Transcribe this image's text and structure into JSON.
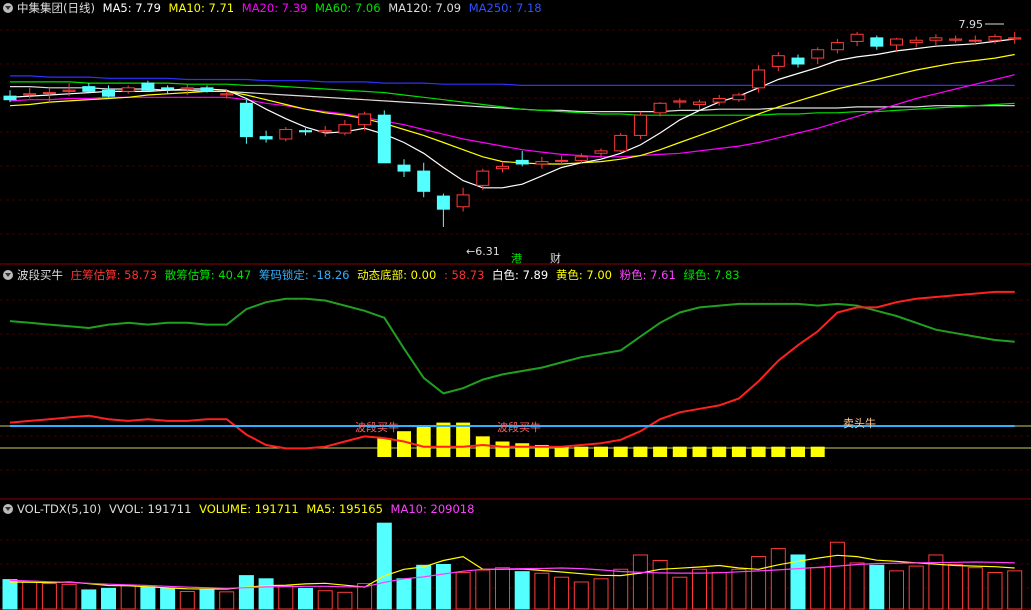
{
  "price_legend": {
    "title": "中集集团(日线)",
    "ma5": "MA5: 7.79",
    "ma10": "MA10: 7.71",
    "ma20": "MA20: 7.39",
    "ma60": "MA60: 7.06",
    "ma120": "MA120: 7.09",
    "ma250": "MA250: 7.18"
  },
  "ind_legend": {
    "title": "波段买牛",
    "i1": "庄筹估算: 58.73",
    "i2": "散筹估算: 40.47",
    "i3": "筹码锁定: -18.26",
    "i4": "动态底部: 0.00",
    "i5": ": 58.73",
    "i6": "白色: 7.89",
    "i7": "黄色: 7.00",
    "i8": "粉色: 7.61",
    "i9": "绿色: 7.83"
  },
  "vol_legend": {
    "title": "VOL-TDX(5,10)",
    "v1": "VVOL: 191711",
    "v2": "VOLUME: 191711",
    "v3": "MA5: 195165",
    "v4": "MA10: 209018"
  },
  "annotations": {
    "high": "7.95",
    "low": "6.31",
    "gang": "港",
    "cai": "财",
    "buy1": "波段买牛",
    "buy2": "波段买牛",
    "sell": "卖头牛"
  },
  "colors": {
    "up": "#ff3b3b",
    "down": "#54ffff",
    "ma5": "#ffffff",
    "ma10": "#ffff00",
    "ma20": "#ff00ff",
    "ma60": "#00e000",
    "ma120": "#dddddd",
    "ma250": "#3030ff",
    "frame": "#8b0000",
    "bar": "#ffff00"
  },
  "chart_data": [
    {
      "type": "candlestick",
      "ylim": [
        6.1,
        8.05
      ],
      "candles": [
        [
          7.41,
          7.46,
          7.36,
          7.38
        ],
        [
          7.42,
          7.48,
          7.39,
          7.43
        ],
        [
          7.44,
          7.49,
          7.35,
          7.44
        ],
        [
          7.45,
          7.52,
          7.41,
          7.46
        ],
        [
          7.49,
          7.52,
          7.44,
          7.45
        ],
        [
          7.46,
          7.5,
          7.4,
          7.41
        ],
        [
          7.45,
          7.5,
          7.43,
          7.48
        ],
        [
          7.52,
          7.54,
          7.45,
          7.46
        ],
        [
          7.48,
          7.5,
          7.43,
          7.47
        ],
        [
          7.47,
          7.51,
          7.42,
          7.48
        ],
        [
          7.48,
          7.5,
          7.44,
          7.45
        ],
        [
          7.42,
          7.46,
          7.39,
          7.43
        ],
        [
          7.35,
          7.38,
          7.01,
          7.07
        ],
        [
          7.07,
          7.12,
          7.02,
          7.05
        ],
        [
          7.05,
          7.15,
          7.03,
          7.13
        ],
        [
          7.12,
          7.14,
          7.08,
          7.11
        ],
        [
          7.11,
          7.16,
          7.07,
          7.12
        ],
        [
          7.1,
          7.21,
          7.08,
          7.17
        ],
        [
          7.17,
          7.28,
          7.12,
          7.26
        ],
        [
          7.25,
          7.29,
          6.85,
          6.85
        ],
        [
          6.83,
          6.88,
          6.73,
          6.78
        ],
        [
          6.78,
          6.85,
          6.56,
          6.61
        ],
        [
          6.57,
          6.59,
          6.31,
          6.46
        ],
        [
          6.48,
          6.64,
          6.44,
          6.58
        ],
        [
          6.66,
          6.8,
          6.62,
          6.78
        ],
        [
          6.8,
          6.86,
          6.77,
          6.82
        ],
        [
          6.87,
          6.95,
          6.82,
          6.84
        ],
        [
          6.84,
          6.9,
          6.8,
          6.86
        ],
        [
          6.87,
          6.91,
          6.83,
          6.87
        ],
        [
          6.87,
          6.93,
          6.84,
          6.9
        ],
        [
          6.93,
          6.97,
          6.89,
          6.95
        ],
        [
          6.95,
          7.1,
          6.94,
          7.08
        ],
        [
          7.08,
          7.28,
          7.05,
          7.25
        ],
        [
          7.27,
          7.36,
          7.24,
          7.35
        ],
        [
          7.36,
          7.39,
          7.31,
          7.37
        ],
        [
          7.34,
          7.38,
          7.3,
          7.36
        ],
        [
          7.36,
          7.42,
          7.33,
          7.39
        ],
        [
          7.38,
          7.44,
          7.36,
          7.42
        ],
        [
          7.48,
          7.67,
          7.44,
          7.63
        ],
        [
          7.66,
          7.78,
          7.62,
          7.75
        ],
        [
          7.73,
          7.76,
          7.65,
          7.68
        ],
        [
          7.73,
          7.82,
          7.68,
          7.8
        ],
        [
          7.8,
          7.89,
          7.77,
          7.86
        ],
        [
          7.87,
          7.95,
          7.83,
          7.93
        ],
        [
          7.9,
          7.92,
          7.8,
          7.83
        ],
        [
          7.84,
          7.9,
          7.79,
          7.89
        ],
        [
          7.86,
          7.91,
          7.82,
          7.88
        ],
        [
          7.88,
          7.93,
          7.84,
          7.9
        ],
        [
          7.88,
          7.92,
          7.86,
          7.89
        ],
        [
          7.88,
          7.92,
          7.84,
          7.88
        ],
        [
          7.88,
          7.93,
          7.85,
          7.91
        ],
        [
          7.89,
          7.95,
          7.85,
          7.9
        ]
      ],
      "ma": {
        "ma5": [
          7.4,
          7.41,
          7.42,
          7.43,
          7.44,
          7.45,
          7.45,
          7.45,
          7.46,
          7.47,
          7.47,
          7.46,
          7.39,
          7.3,
          7.22,
          7.15,
          7.1,
          7.11,
          7.14,
          7.09,
          7.02,
          6.93,
          6.81,
          6.7,
          6.64,
          6.64,
          6.67,
          6.74,
          6.81,
          6.85,
          6.88,
          6.93,
          7.0,
          7.1,
          7.21,
          7.29,
          7.36,
          7.41,
          7.48,
          7.55,
          7.6,
          7.65,
          7.71,
          7.74,
          7.76,
          7.79,
          7.81,
          7.83,
          7.84,
          7.85,
          7.87,
          7.89
        ],
        "ma10": [
          7.33,
          7.34,
          7.36,
          7.37,
          7.38,
          7.39,
          7.4,
          7.42,
          7.43,
          7.44,
          7.45,
          7.45,
          7.42,
          7.38,
          7.34,
          7.3,
          7.27,
          7.25,
          7.22,
          7.18,
          7.13,
          7.08,
          7.02,
          6.96,
          6.9,
          6.86,
          6.85,
          6.84,
          6.84,
          6.85,
          6.86,
          6.88,
          6.91,
          6.96,
          7.02,
          7.08,
          7.14,
          7.2,
          7.26,
          7.32,
          7.37,
          7.42,
          7.47,
          7.51,
          7.55,
          7.59,
          7.63,
          7.66,
          7.69,
          7.71,
          7.73,
          7.76
        ],
        "ma20": [
          7.37,
          7.38,
          7.38,
          7.39,
          7.39,
          7.4,
          7.4,
          7.4,
          7.4,
          7.4,
          7.4,
          7.4,
          7.38,
          7.35,
          7.33,
          7.3,
          7.28,
          7.26,
          7.23,
          7.2,
          7.17,
          7.13,
          7.09,
          7.05,
          7.02,
          6.99,
          6.96,
          6.94,
          6.92,
          6.91,
          6.9,
          6.9,
          6.91,
          6.92,
          6.93,
          6.95,
          6.97,
          6.99,
          7.02,
          7.06,
          7.1,
          7.14,
          7.19,
          7.24,
          7.29,
          7.34,
          7.39,
          7.43,
          7.47,
          7.51,
          7.55,
          7.59
        ],
        "ma60": [
          7.53,
          7.53,
          7.53,
          7.53,
          7.52,
          7.52,
          7.52,
          7.52,
          7.52,
          7.51,
          7.51,
          7.51,
          7.5,
          7.5,
          7.49,
          7.48,
          7.47,
          7.46,
          7.45,
          7.44,
          7.42,
          7.4,
          7.38,
          7.36,
          7.34,
          7.32,
          7.3,
          7.29,
          7.28,
          7.27,
          7.26,
          7.26,
          7.25,
          7.25,
          7.25,
          7.25,
          7.25,
          7.25,
          7.25,
          7.26,
          7.26,
          7.27,
          7.27,
          7.28,
          7.28,
          7.29,
          7.3,
          7.31,
          7.32,
          7.33,
          7.34,
          7.35
        ],
        "ma120": [
          7.49,
          7.49,
          7.48,
          7.48,
          7.48,
          7.47,
          7.47,
          7.47,
          7.46,
          7.46,
          7.45,
          7.45,
          7.44,
          7.43,
          7.42,
          7.41,
          7.4,
          7.39,
          7.38,
          7.37,
          7.36,
          7.35,
          7.34,
          7.33,
          7.32,
          7.31,
          7.3,
          7.29,
          7.29,
          7.28,
          7.28,
          7.28,
          7.28,
          7.28,
          7.29,
          7.29,
          7.3,
          7.3,
          7.3,
          7.31,
          7.31,
          7.31,
          7.31,
          7.32,
          7.32,
          7.32,
          7.32,
          7.33,
          7.33,
          7.33,
          7.33,
          7.33
        ],
        "ma250": [
          7.58,
          7.58,
          7.57,
          7.57,
          7.57,
          7.56,
          7.56,
          7.56,
          7.56,
          7.55,
          7.55,
          7.55,
          7.55,
          7.54,
          7.54,
          7.54,
          7.53,
          7.53,
          7.53,
          7.52,
          7.52,
          7.52,
          7.51,
          7.51,
          7.51,
          7.51,
          7.5,
          7.5,
          7.5,
          7.5,
          7.5,
          7.5,
          7.5,
          7.5,
          7.5,
          7.5,
          7.5,
          7.5,
          7.5,
          7.5,
          7.5,
          7.5,
          7.5,
          7.5,
          7.5,
          7.5,
          7.5,
          7.5,
          7.5,
          7.5,
          7.5,
          7.5
        ]
      }
    },
    {
      "type": "line",
      "ylim": [
        -25,
        100
      ],
      "series": [
        {
          "name": "庄筹估算",
          "values": [
            20,
            21,
            22,
            23,
            24,
            22,
            21,
            22,
            21,
            21,
            22,
            22,
            13,
            7,
            5,
            5,
            6,
            9,
            12,
            11,
            9,
            6,
            6,
            6,
            7,
            6,
            6,
            6,
            6,
            7,
            8,
            10,
            15,
            22,
            26,
            28,
            30,
            34,
            44,
            56,
            65,
            73,
            84,
            87,
            87,
            90,
            92,
            93,
            94,
            95,
            96,
            96
          ]
        },
        {
          "name": "散筹估算",
          "values": [
            79,
            78,
            77,
            76,
            75,
            77,
            78,
            77,
            78,
            78,
            77,
            77,
            86,
            90,
            92,
            92,
            91,
            88,
            85,
            81,
            63,
            46,
            37,
            40,
            45,
            48,
            50,
            52,
            55,
            58,
            60,
            62,
            70,
            78,
            84,
            87,
            88,
            89,
            89,
            89,
            89,
            88,
            89,
            88,
            85,
            82,
            78,
            74,
            72,
            70,
            68,
            67
          ]
        },
        {
          "name": "筹码锁定",
          "values": [
            -18,
            -18,
            -18,
            -18,
            -18,
            -18,
            -18,
            -18,
            -18,
            -18,
            -18,
            -18,
            -18,
            -18,
            -18,
            -18,
            -18,
            -18,
            -18,
            -18,
            -18,
            -18,
            -18,
            -18,
            -18,
            -18,
            -18,
            -18,
            -18,
            -18,
            -18,
            -18,
            -18,
            -18,
            -18,
            -18,
            -18,
            -18,
            -18,
            -18,
            -18,
            -18,
            -18,
            -18,
            -18,
            -18,
            -18,
            -18,
            -18,
            -18,
            -18,
            -18
          ]
        },
        {
          "name": "动态底部",
          "values": [
            0,
            0,
            0,
            0,
            0,
            0,
            0,
            0,
            0,
            0,
            0,
            0,
            0,
            0,
            0,
            0,
            0,
            0,
            0,
            11,
            15,
            18,
            20,
            20,
            12,
            9,
            8,
            7,
            6,
            6,
            6,
            6,
            6,
            6,
            6,
            6,
            6,
            6,
            6,
            6,
            6,
            6,
            0,
            0,
            0,
            0,
            0,
            0,
            0,
            0,
            0,
            0
          ]
        }
      ]
    },
    {
      "type": "bar",
      "ylim": [
        0,
        560000
      ],
      "series": [
        {
          "name": "VOLUME",
          "values": [
            185000,
            175000,
            160000,
            155000,
            120000,
            130000,
            150000,
            140000,
            130000,
            110000,
            120000,
            108000,
            210000,
            190000,
            145000,
            130000,
            115000,
            105000,
            160000,
            540000,
            190000,
            275000,
            280000,
            230000,
            245000,
            260000,
            235000,
            225000,
            200000,
            170000,
            190000,
            250000,
            340000,
            305000,
            200000,
            250000,
            230000,
            250000,
            330000,
            380000,
            340000,
            260000,
            420000,
            290000,
            275000,
            240000,
            270000,
            340000,
            280000,
            260000,
            230000,
            240000
          ]
        },
        {
          "name": "MA5",
          "values": [
            170000,
            168000,
            167000,
            170000,
            160000,
            148000,
            146000,
            140000,
            133000,
            127000,
            126000,
            126000,
            137000,
            147000,
            150000,
            158000,
            162000,
            150000,
            138000,
            208000,
            250000,
            265000,
            305000,
            330000,
            250000,
            250000,
            252000,
            242000,
            233000,
            222000,
            212000,
            210000,
            226000,
            250000,
            257000,
            264000,
            274000,
            258000,
            250000,
            278000,
            300000,
            320000,
            338000,
            330000,
            307000,
            300000,
            290000,
            282000,
            274000,
            270000,
            266000,
            258000
          ]
        },
        {
          "name": "MA10",
          "values": [
            180000,
            176000,
            172000,
            168000,
            162000,
            156000,
            152000,
            148000,
            143000,
            138000,
            134000,
            130000,
            134000,
            139000,
            141000,
            143000,
            143000,
            140000,
            139000,
            168000,
            190000,
            202000,
            220000,
            238000,
            250000,
            252000,
            254000,
            255000,
            258000,
            254000,
            246000,
            236000,
            231000,
            227000,
            226000,
            226000,
            228000,
            234000,
            240000,
            246000,
            254000,
            262000,
            270000,
            280000,
            286000,
            288000,
            290000,
            292000,
            294000,
            296000,
            294000,
            290000
          ]
        }
      ]
    }
  ]
}
